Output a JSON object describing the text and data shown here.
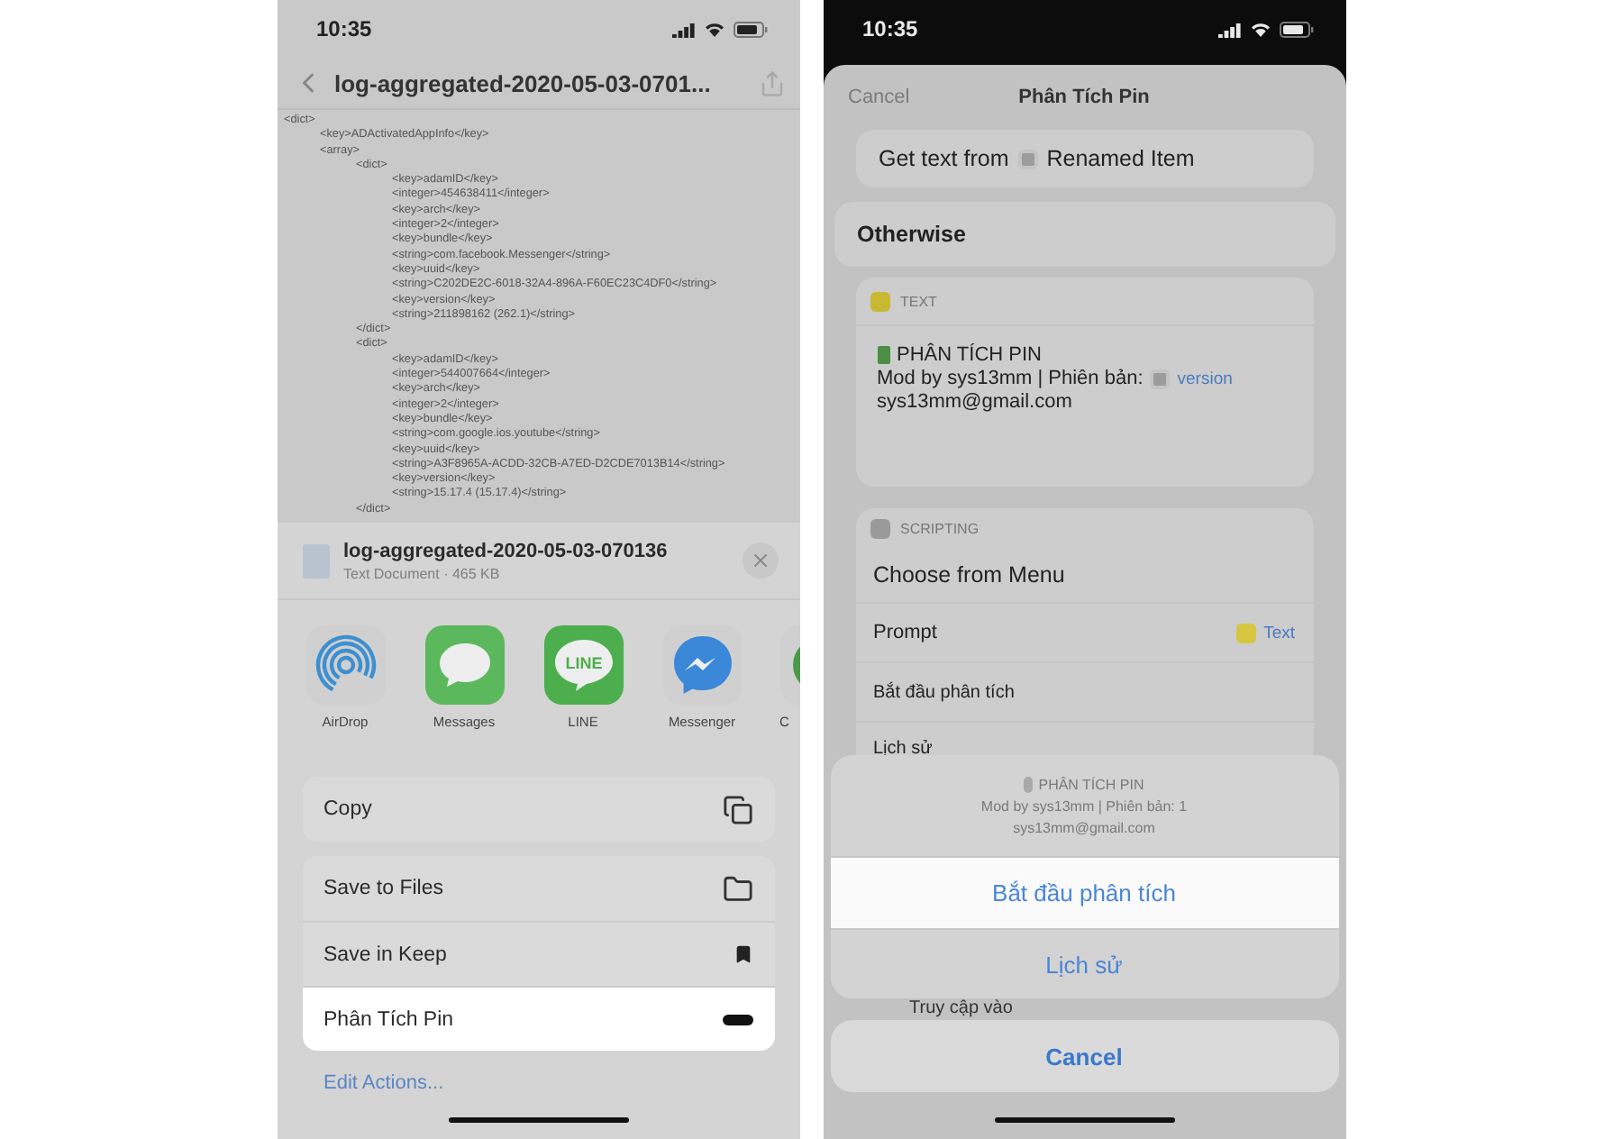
{
  "left": {
    "status": {
      "time": "10:35"
    },
    "nav": {
      "title": "log-aggregated-2020-05-03-0701..."
    },
    "listing": [
      {
        "text": "<dict>",
        "children": [
          {
            "text": "<key>ADActivatedAppInfo</key>"
          },
          {
            "text": "<array>",
            "children": [
              {
                "text": "<dict>",
                "children": [
                  {
                    "text": "<key>adamID</key>"
                  },
                  {
                    "text": "<integer>454638411</integer>"
                  },
                  {
                    "text": "<key>arch</key>"
                  },
                  {
                    "text": "<integer>2</integer>"
                  },
                  {
                    "text": "<key>bundle</key>"
                  },
                  {
                    "text": "<string>com.facebook.Messenger</string>"
                  },
                  {
                    "text": "<key>uuid</key>"
                  },
                  {
                    "text": "<string>C202DE2C-6018-32A4-896A-F60EC23C4DF0</string>"
                  },
                  {
                    "text": "<key>version</key>"
                  },
                  {
                    "text": "<string>211898162 (262.1)</string>"
                  }
                ]
              },
              {
                "text": "</dict>"
              },
              {
                "text": "<dict>",
                "children": [
                  {
                    "text": "<key>adamID</key>"
                  },
                  {
                    "text": "<integer>544007664</integer>"
                  },
                  {
                    "text": "<key>arch</key>"
                  },
                  {
                    "text": "<integer>2</integer>"
                  },
                  {
                    "text": "<key>bundle</key>"
                  },
                  {
                    "text": "<string>com.google.ios.youtube</string>"
                  },
                  {
                    "text": "<key>uuid</key>"
                  },
                  {
                    "text": "<string>A3F8965A-ACDD-32CB-A7ED-D2CDE7013B14</string>"
                  },
                  {
                    "text": "<key>version</key>"
                  },
                  {
                    "text": "<string>15.17.4 (15.17.4)</string>"
                  }
                ]
              },
              {
                "text": "</dict>"
              }
            ]
          }
        ]
      }
    ],
    "share": {
      "file_name": "log-aggregated-2020-05-03-070136",
      "file_info": "Text Document · 465 KB",
      "apps": [
        {
          "label": "AirDrop",
          "kind": "airdrop"
        },
        {
          "label": "Messages",
          "kind": "messages"
        },
        {
          "label": "LINE",
          "kind": "line",
          "logo_text": "LINE"
        },
        {
          "label": "Messenger",
          "kind": "messenger"
        },
        {
          "label": "C",
          "kind": "chrome"
        }
      ],
      "actions": [
        {
          "label": "Copy",
          "kind": "copy",
          "selected": false
        },
        {
          "label": "Save to Files",
          "kind": "folder",
          "selected": false
        },
        {
          "label": "Save in Keep",
          "kind": "bookmark",
          "selected": false
        },
        {
          "label": "Phân Tích Pin",
          "kind": "bar",
          "selected": true
        }
      ],
      "edit_link": "Edit Actions..."
    }
  },
  "right": {
    "status": {
      "time": "10:35"
    },
    "header": {
      "cancel": "Cancel",
      "title": "Phân Tích Pin"
    },
    "get_text": {
      "label": "Get text from",
      "variable": "Renamed Item"
    },
    "otherwise": "Otherwise",
    "text_action": {
      "category": "TEXT",
      "title": "PHÂN TÍCH PIN",
      "line": "Mod by sys13mm | Phiên bản:",
      "variable": "version",
      "email": "sys13mm@gmail.com"
    },
    "menu_action": {
      "category": "SCRIPTING",
      "title": "Choose from Menu",
      "prompt_label": "Prompt",
      "prompt_value": "Text",
      "items": [
        "Bắt đầu phân tích",
        "Lịch sử"
      ]
    },
    "action_sheet": {
      "title": "PHÂN TÍCH PIN",
      "lines": [
        "Mod by sys13mm | Phiên bản: 1",
        "sys13mm@gmail.com"
      ],
      "options": [
        {
          "label": "Bắt đầu phân tích",
          "selected": true
        },
        {
          "label": "Lịch sử",
          "selected": false
        }
      ],
      "peek": "Truy cập vào",
      "cancel": "Cancel"
    }
  }
}
